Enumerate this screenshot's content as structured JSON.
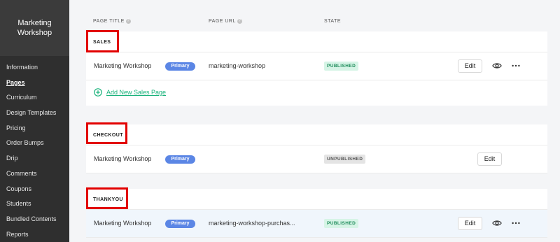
{
  "sidebar": {
    "course_title": "Marketing Workshop",
    "items": [
      {
        "label": "Information"
      },
      {
        "label": "Pages",
        "active": true
      },
      {
        "label": "Curriculum"
      },
      {
        "label": "Design Templates"
      },
      {
        "label": "Pricing"
      },
      {
        "label": "Order Bumps"
      },
      {
        "label": "Drip"
      },
      {
        "label": "Comments"
      },
      {
        "label": "Coupons"
      },
      {
        "label": "Students"
      },
      {
        "label": "Bundled Contents"
      },
      {
        "label": "Reports"
      }
    ]
  },
  "table": {
    "columns": {
      "page_title": "PAGE TITLE",
      "page_url": "PAGE URL",
      "state": "STATE"
    },
    "help_icon": "question-circle-icon"
  },
  "sections": {
    "sales": {
      "label": "SALES",
      "row": {
        "title": "Marketing Workshop",
        "badge": "Primary",
        "url": "marketing-workshop",
        "state": "PUBLISHED",
        "edit": "Edit"
      },
      "add_link": "Add New Sales Page"
    },
    "checkout": {
      "label": "CHECKOUT",
      "row": {
        "title": "Marketing Workshop",
        "badge": "Primary",
        "url": "",
        "state": "UNPUBLISHED",
        "edit": "Edit"
      }
    },
    "thankyou": {
      "label": "THANKYOU",
      "row": {
        "title": "Marketing Workshop",
        "badge": "Primary",
        "url": "marketing-workshop-purchas...",
        "state": "PUBLISHED",
        "edit": "Edit"
      }
    }
  },
  "colors": {
    "sidebar_bg": "#2f2f2f",
    "primary_badge": "#5b86e5",
    "published": "#1f8c5b",
    "add_link": "#18b27a",
    "highlight_box": "#e20000"
  }
}
